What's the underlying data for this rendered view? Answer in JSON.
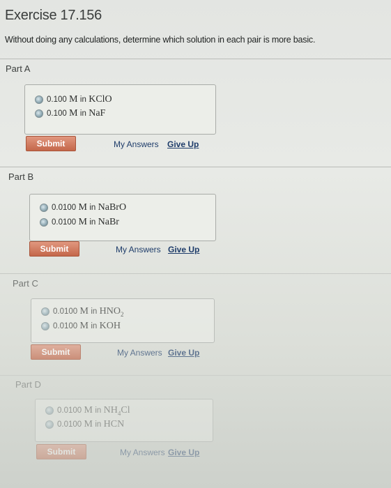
{
  "header": {
    "title": "Exercise 17.156",
    "instructions": "Without doing any calculations, determine which solution in each pair is more basic."
  },
  "actions": {
    "submit_label": "Submit",
    "my_answers_label": "My Answers",
    "give_up_label": "Give Up"
  },
  "parts": [
    {
      "label": "Part A",
      "choices": [
        {
          "concentration": "0.100",
          "unit": "M",
          "word": "in",
          "compound": "KClO"
        },
        {
          "concentration": "0.100",
          "unit": "M",
          "word": "in",
          "compound": "NaF"
        }
      ]
    },
    {
      "label": "Part B",
      "choices": [
        {
          "concentration": "0.0100",
          "unit": "M",
          "word": "in",
          "compound": "NaBrO"
        },
        {
          "concentration": "0.0100",
          "unit": "M",
          "word": "in",
          "compound": "NaBr"
        }
      ]
    },
    {
      "label": "Part C",
      "choices": [
        {
          "concentration": "0.0100",
          "unit": "M",
          "word": "in",
          "compound": "HNO",
          "subscript": "2"
        },
        {
          "concentration": "0.0100",
          "unit": "M",
          "word": "in",
          "compound": "KOH"
        }
      ]
    },
    {
      "label": "Part D",
      "choices": [
        {
          "concentration": "0.0100",
          "unit": "M",
          "word": "in",
          "compound": "NH",
          "subscript": "4",
          "suffix": "Cl"
        },
        {
          "concentration": "0.0100",
          "unit": "M",
          "word": "in",
          "compound": "HCN"
        }
      ]
    }
  ],
  "colors": {
    "submit_bg": "#c4674a",
    "link": "#1e3c6a",
    "page_bg": "#e3e5e2"
  }
}
